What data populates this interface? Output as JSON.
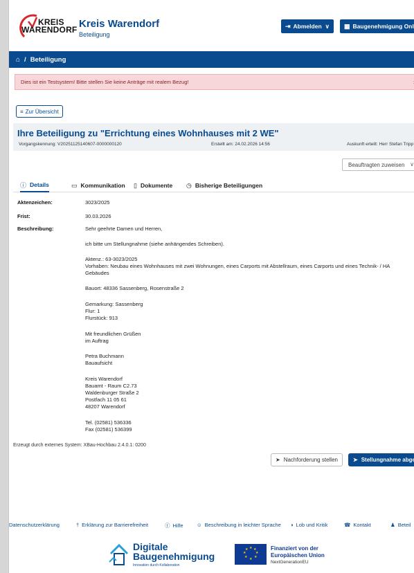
{
  "header": {
    "logo_line1": "KREIS",
    "logo_line2": "WARENDORF",
    "brand_name": "Kreis Warendorf",
    "brand_sub": "Beteiligung",
    "logout_label": "Abmelden",
    "baugenehmigung_label": "Baugenehmigung Online"
  },
  "breadcrumb": {
    "current": "Beteiligung"
  },
  "alert": {
    "text": "Dies ist ein Testsystem! Bitte stellen Sie keine Anträge mit realem Bezug!",
    "close": "×"
  },
  "back_button": "Zur Übersicht",
  "procedure": {
    "title": "Ihre Beteiligung zu \"Errichtung eines Wohnhauses mit 2 WE\"",
    "kennung": "Vorgangskennung: V20251125140607-0000000120",
    "erstellt": "Erstellt am: 24.02.2026 14:56",
    "auskunft": "Auskunft erteilt: Herr Stefan Tripp"
  },
  "assign_select": "Beauftragten zuweisen",
  "tabs": [
    {
      "label": "Details"
    },
    {
      "label": "Kommunikation"
    },
    {
      "label": "Dokumente"
    },
    {
      "label": "Bisherige Beteiligungen"
    }
  ],
  "details": {
    "aktenzeichen_label": "Aktenzeichen:",
    "aktenzeichen": "3023/2025",
    "frist_label": "Frist:",
    "frist": "30.03.2026",
    "beschreibung_label": "Beschreibung:",
    "lines": [
      "Sehr geehrte Damen und Herren,",
      "ich bitte um Stellungnahme (siehe anhängendes Schreiben).",
      "Aktenz.: 63-3023/2025",
      "Vorhaben: Neubau eines Wohnhauses mit zwei Wohnungen, eines Carports mit Abstellraum, eines Carports und eines Technik- / HA",
      "Gebäudes",
      "Bauort: 48336 Sassenberg, Rosenstraße 2",
      "Gemarkung: Sassenberg",
      "Flur: 1",
      "Flurstück: 913",
      "Mit freundlichen Grüßen",
      "im Auftrag",
      "Petra Buchmann",
      "Bauaufsicht",
      "Kreis Warendorf",
      "Bauamt - Raum C2.73",
      "Waldenburger Straße 2",
      "Postfach 11 05 61",
      "48207 Warendorf",
      "Tel. (02581) 536336",
      "Fax (02581) 536399"
    ]
  },
  "generated_by": "Erzeugt durch externes System: XBau-Hochbau 2.4.0.1: 0200",
  "actions": {
    "nachforderung": "Nachforderung stellen",
    "stellungnahme": "Stellungnahme abgeben"
  },
  "footer": {
    "links": [
      "Datenschutzerklärung",
      "Erklärung zur Barrierefreiheit",
      "Hilfe",
      "Beschreibung in leichter Sprache",
      "Lob und Kritik",
      "Kontakt",
      "Beteil"
    ],
    "db_line1": "Digitale",
    "db_line2": "Baugenehmigung",
    "db_line3": "Innovation durch Kollaboration",
    "eu_line1": "Finanziert von der",
    "eu_line2": "Europäischen Union",
    "eu_line3": "NextGenerationEU"
  },
  "colors": {
    "brand_blue": "#0a4a8f",
    "alert_bg": "#f8d7da",
    "logo_red": "#d9262b"
  }
}
